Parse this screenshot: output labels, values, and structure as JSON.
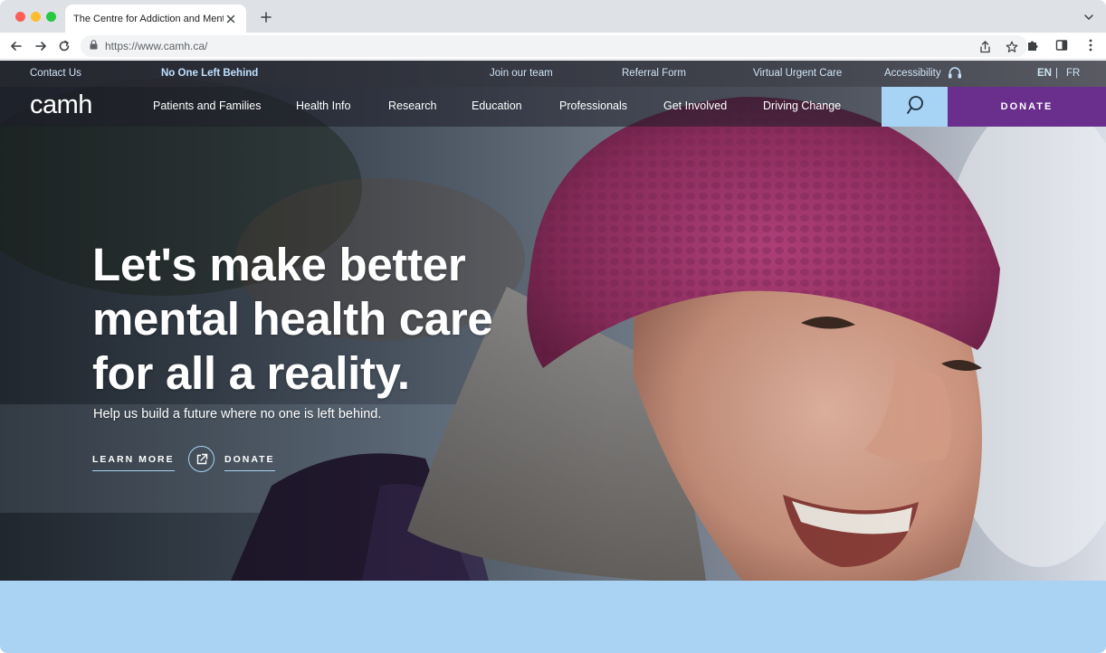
{
  "browser": {
    "tab_title": "The Centre for Addiction and Ment...",
    "url": "https://www.camh.ca/"
  },
  "utility_bar": {
    "contact": "Contact Us",
    "campaign": "No One Left Behind",
    "join": "Join our team",
    "referral": "Referral Form",
    "urgent_care": "Virtual Urgent Care",
    "accessibility": "Accessibility",
    "lang_en": "EN",
    "lang_sep": "|",
    "lang_fr": "FR"
  },
  "main_nav": {
    "logo": "camh",
    "items": [
      "Patients and Families",
      "Health Info",
      "Research",
      "Education",
      "Professionals",
      "Get Involved",
      "Driving Change"
    ],
    "donate": "DONATE"
  },
  "hero": {
    "headline_line1": "Let's make better",
    "headline_line2": "mental health care",
    "headline_line3": "for all a reality.",
    "subline": "Help us build a future where no one is left behind.",
    "learn_more": "LEARN MORE",
    "donate": "DONATE"
  },
  "colors": {
    "accent_blue": "#a7d3f5",
    "brand_purple": "#6a2f8c",
    "band_blue": "#a9d2f3"
  }
}
